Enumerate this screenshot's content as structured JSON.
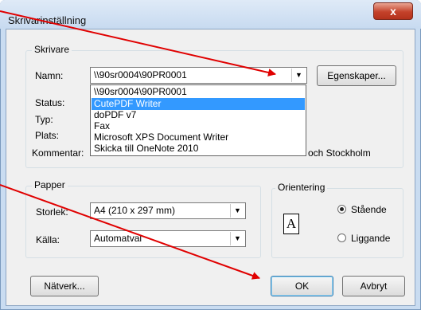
{
  "window": {
    "title": "Skrivarinställning",
    "close_glyph": "x"
  },
  "printer_group": {
    "legend": "Skrivare",
    "name_label": "Namn:",
    "selected_printer": "\\\\90sr0004\\90PR0001",
    "properties_button": "Egenskaper...",
    "status_label": "Status:",
    "type_label": "Typ:",
    "location_label": "Plats:",
    "comment_label": "Kommentar:",
    "comment_value_tail": "och Stockholm",
    "dropdown_items": [
      {
        "label": "\\\\90sr0004\\90PR0001"
      },
      {
        "label": "CutePDF Writer"
      },
      {
        "label": "doPDF v7"
      },
      {
        "label": "Fax"
      },
      {
        "label": "Microsoft XPS Document Writer"
      },
      {
        "label": "Skicka till OneNote 2010"
      }
    ]
  },
  "paper_group": {
    "legend": "Papper",
    "size_label": "Storlek:",
    "size_value": "A4 (210 x 297 mm)",
    "source_label": "Källa:",
    "source_value": "Automatval"
  },
  "orientation_group": {
    "legend": "Orientering",
    "page_icon_letter": "A",
    "portrait_label": "Stående",
    "landscape_label": "Liggande",
    "selected": "portrait"
  },
  "buttons": {
    "network": "Nätverk...",
    "ok": "OK",
    "cancel": "Avbryt"
  },
  "colors": {
    "annotation_arrow": "#e00000",
    "selection": "#3399ff"
  }
}
